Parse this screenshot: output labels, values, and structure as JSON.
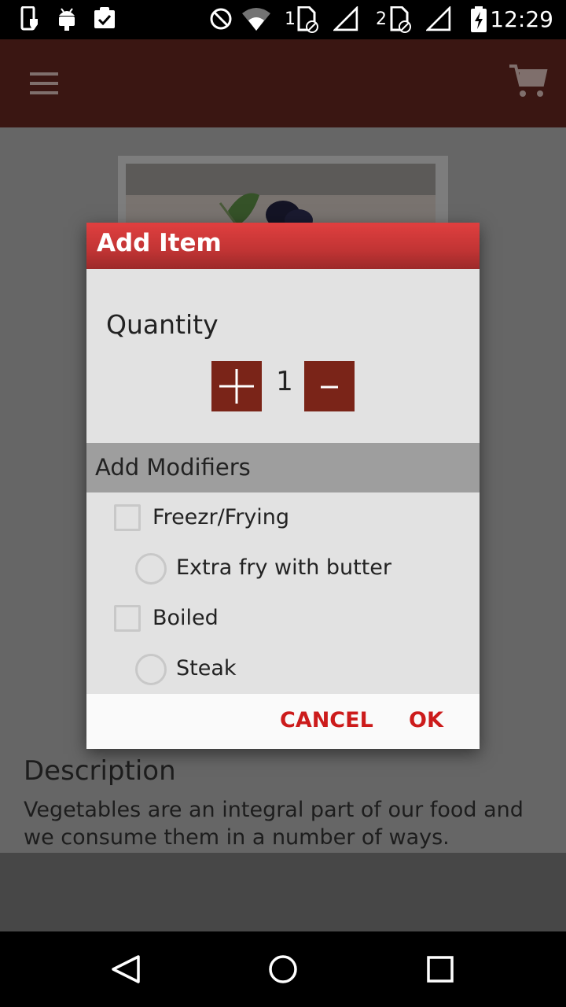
{
  "status_bar": {
    "time": "12:29",
    "sim1_label": "1",
    "sim2_label": "2",
    "icons": [
      "phone-shield-icon",
      "android-icon",
      "clipboard-check-icon",
      "do-not-disturb-icon",
      "wifi-icon",
      "sim1-icon",
      "signal-icon",
      "sim2-icon",
      "signal-icon",
      "battery-charging-icon"
    ]
  },
  "app_bar": {
    "menu_icon": "hamburger-menu-icon",
    "cart_icon": "shopping-cart-icon"
  },
  "product": {
    "description_title": "Description",
    "description_text": "Vegetables are an integral part of our food and we consume them in a number of ways."
  },
  "dialog": {
    "title": "Add Item",
    "quantity_label": "Quantity",
    "quantity_value": "1",
    "plus_icon": "plus-icon",
    "minus_icon": "minus-icon",
    "modifiers_title": "Add Modifiers",
    "modifiers": [
      {
        "type": "checkbox",
        "label": "Freezr/Frying",
        "checked": false
      },
      {
        "type": "radio",
        "label": "Extra fry with butter",
        "checked": false
      },
      {
        "type": "checkbox",
        "label": "Boiled",
        "checked": false
      },
      {
        "type": "radio",
        "label": "Steak",
        "checked": false
      }
    ],
    "cancel_label": "CANCEL",
    "ok_label": "OK"
  },
  "nav_bar": {
    "icons": [
      "back-icon",
      "home-icon",
      "recents-icon"
    ]
  },
  "colors": {
    "accent": "#cc1b1b",
    "app_bar": "#3a1612",
    "qty_button": "#7a2418",
    "dialog_header": "#c13434"
  }
}
